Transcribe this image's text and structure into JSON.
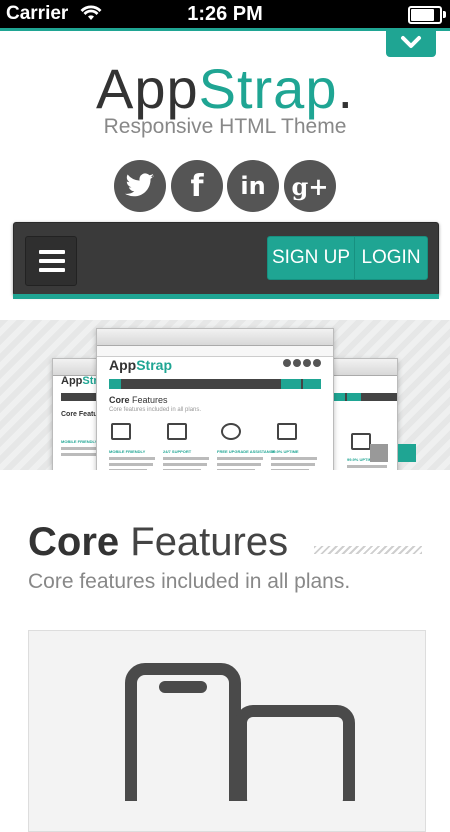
{
  "status_bar": {
    "carrier": "Carrier",
    "time": "1:26 PM",
    "battery_level": 0.9
  },
  "header": {
    "logo_part1": "App",
    "logo_part2": "Strap",
    "logo_dot": ".",
    "tagline": "Responsive HTML Theme",
    "collapse_icon": "chevron-down-icon"
  },
  "social": [
    {
      "name": "twitter-icon"
    },
    {
      "name": "facebook-icon",
      "glyph": "f"
    },
    {
      "name": "linkedin-icon",
      "glyph": "in"
    },
    {
      "name": "google-plus-icon",
      "glyph": "g+"
    }
  ],
  "navbar": {
    "menu_icon": "hamburger-menu-icon",
    "signup_label": "SIGN UP",
    "login_label": "LOGIN"
  },
  "hero": {
    "screenshot": {
      "logo_a": "App",
      "logo_b": "Strap",
      "features_title_bold": "Core",
      "features_title_rest": " Features",
      "features_sub": "Core features included in all plans.",
      "columns": [
        "MOBILE FRIENDLY",
        "24/7 SUPPORT",
        "FREE UPGRADE ASSISTANCE",
        "99.9% UPTIME"
      ]
    }
  },
  "features": {
    "title_bold": "Core",
    "title_rest": " Features",
    "subtitle": "Core features included in all plans."
  },
  "colors": {
    "accent": "#1fa593",
    "dark": "#3a3a3a",
    "text": "#333333",
    "muted": "#888888"
  }
}
